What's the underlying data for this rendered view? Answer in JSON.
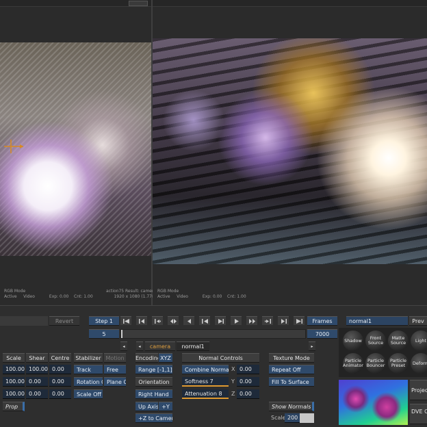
{
  "viewer_left": {
    "mode": "RGB Mode",
    "status": "Active",
    "channel": "Video",
    "exposure": "Exp: 0.00",
    "contrast": "Cnt: 1.00",
    "result": "action75 Result: camera",
    "resolution": "1920 x 1080 (1.778)"
  },
  "viewer_right": {
    "mode": "RGB Mode",
    "status": "Active",
    "channel": "Video",
    "exposure": "Exp: 0.00",
    "contrast": "Cnt: 1.00"
  },
  "timeline": {
    "revert": "Revert",
    "step": "Step 1",
    "frame": "5",
    "frames_label": "Frames",
    "frames_total": "7000",
    "transport": [
      "go-start",
      "step-back-key",
      "prev-key",
      "step-back-fast",
      "step-back",
      "play-reverse",
      "stop",
      "play",
      "step-forward-fast",
      "next-key",
      "step-forward-key",
      "go-end"
    ]
  },
  "tabs": [
    "camera",
    "normal1"
  ],
  "left_panel": {
    "header_buttons": [
      "Scale",
      "Shear",
      "Centre"
    ],
    "rows": [
      [
        "100.00",
        "100.00",
        "0.00"
      ],
      [
        "100.00",
        "0.00",
        "0.00"
      ],
      [
        "100.00",
        "0.00",
        "0.00"
      ]
    ],
    "prop": "Prop",
    "side_buttons": [
      "Stabilizer",
      "Track",
      "Rotation Off",
      "Scale Off"
    ],
    "side2_buttons": [
      "Motion",
      "Free",
      "Plane Off"
    ]
  },
  "normal_panel": {
    "encoding_label": "Encoding",
    "encoding_value": "XYZ",
    "range": "Range [-1,1]",
    "orientation": "Orientation",
    "hand": "Right Hand",
    "up_axis": "Up Axis",
    "axis_value": "+Y",
    "to_camera": "+Z to Camera",
    "controls_title": "Normal Controls",
    "combine": "Combine Normals",
    "softness": "Softness 7",
    "attenuation": "Attenuation 8",
    "xyz": [
      {
        "axis": "X",
        "value": "0.00"
      },
      {
        "axis": "Y",
        "value": "0.00"
      },
      {
        "axis": "Z",
        "value": "0.00"
      }
    ],
    "texture_mode": "Texture Mode",
    "repeat": "Repeat Off",
    "fill": "Fill To Surface",
    "show_normals": "Show Normals",
    "scale_label": "Scale",
    "scale_value": "200"
  },
  "node_panel": {
    "name": "normal1",
    "prev": "Prev",
    "nodes": [
      "Shadow",
      "Front Source",
      "Matte Source",
      "Light",
      "Particle Animator",
      "Particle Bouncer",
      "Particle Preset",
      "Deform"
    ],
    "projector": "Projector",
    "dve": "DVE Object"
  }
}
